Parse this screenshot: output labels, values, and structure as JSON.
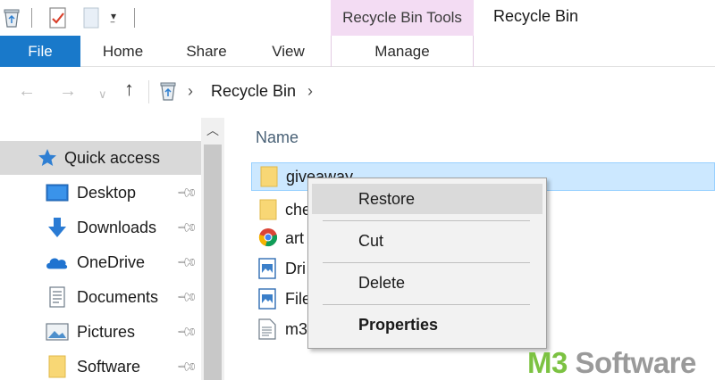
{
  "window": {
    "title": "Recycle Bin"
  },
  "ribbon": {
    "context_group": "Recycle Bin Tools",
    "tabs": [
      {
        "label": "File",
        "active": true
      },
      {
        "label": "Home"
      },
      {
        "label": "Share"
      },
      {
        "label": "View"
      },
      {
        "label": "Manage"
      }
    ]
  },
  "address": {
    "path": [
      "Recycle Bin"
    ]
  },
  "nav_pane": {
    "items": [
      {
        "label": "Quick access",
        "icon": "star-icon",
        "selected": true
      },
      {
        "label": "Desktop",
        "icon": "desktop-icon",
        "pinned": true
      },
      {
        "label": "Downloads",
        "icon": "download-icon",
        "pinned": true
      },
      {
        "label": "OneDrive",
        "icon": "cloud-icon",
        "pinned": true
      },
      {
        "label": "Documents",
        "icon": "documents-icon",
        "pinned": true
      },
      {
        "label": "Pictures",
        "icon": "pictures-icon",
        "pinned": true
      },
      {
        "label": "Software",
        "icon": "folder-icon",
        "pinned": true
      }
    ]
  },
  "file_list": {
    "column": "Name",
    "files": [
      {
        "name": "giveaway",
        "icon": "folder-icon",
        "selected": true
      },
      {
        "name": "che",
        "icon": "folder-icon"
      },
      {
        "name": "art",
        "icon": "chrome-icon"
      },
      {
        "name": "Dri",
        "icon": "picture-file-icon"
      },
      {
        "name": "File",
        "icon": "picture-file-icon"
      },
      {
        "name": "m3",
        "icon": "text-file-icon"
      }
    ]
  },
  "context_menu": {
    "items": [
      {
        "label": "Restore",
        "highlighted": true
      },
      {
        "label": "Cut"
      },
      {
        "label": "Delete"
      },
      {
        "label": "Properties",
        "bold": true
      }
    ]
  },
  "watermark": {
    "brand": "M3",
    "suffix": " Software"
  },
  "colors": {
    "file_tab": "#1979ca",
    "context_group": "#f3dcf3",
    "selection": "#cce8ff",
    "watermark_green": "#7cc242"
  }
}
